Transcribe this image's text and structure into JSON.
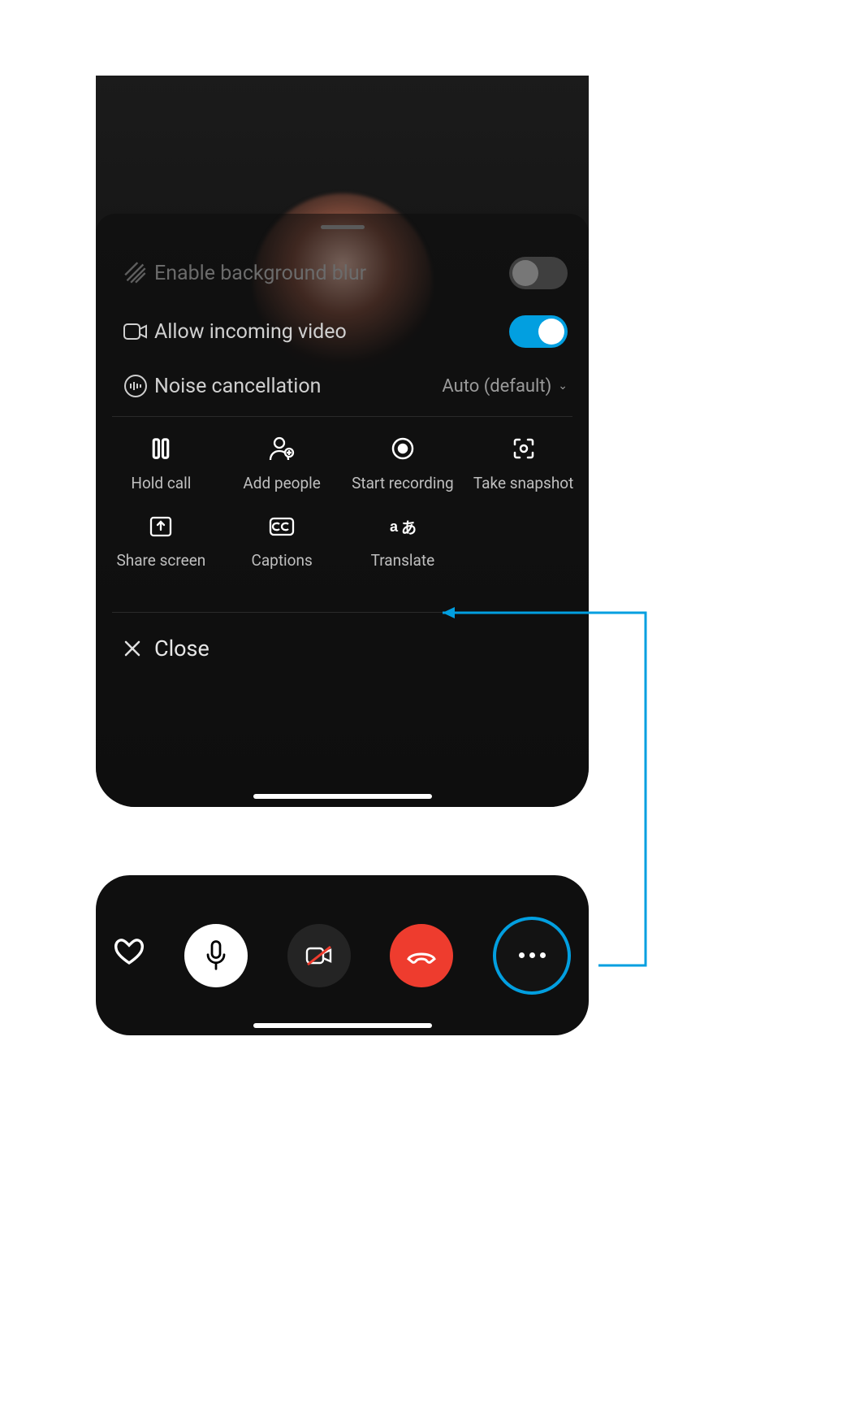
{
  "settings": {
    "blur": {
      "label": "Enable background blur",
      "enabled": false
    },
    "incoming": {
      "label": "Allow incoming video",
      "enabled": true
    },
    "noise": {
      "label": "Noise cancellation",
      "value": "Auto (default)"
    }
  },
  "actions": [
    {
      "id": "hold",
      "label": "Hold call"
    },
    {
      "id": "add",
      "label": "Add people"
    },
    {
      "id": "record",
      "label": "Start recording"
    },
    {
      "id": "snapshot",
      "label": "Take snapshot"
    },
    {
      "id": "share",
      "label": "Share screen"
    },
    {
      "id": "captions",
      "label": "Captions"
    },
    {
      "id": "translate",
      "label": "Translate"
    }
  ],
  "close_label": "Close",
  "colors": {
    "accent": "#029fe0",
    "hangup": "#ee3c2e"
  }
}
